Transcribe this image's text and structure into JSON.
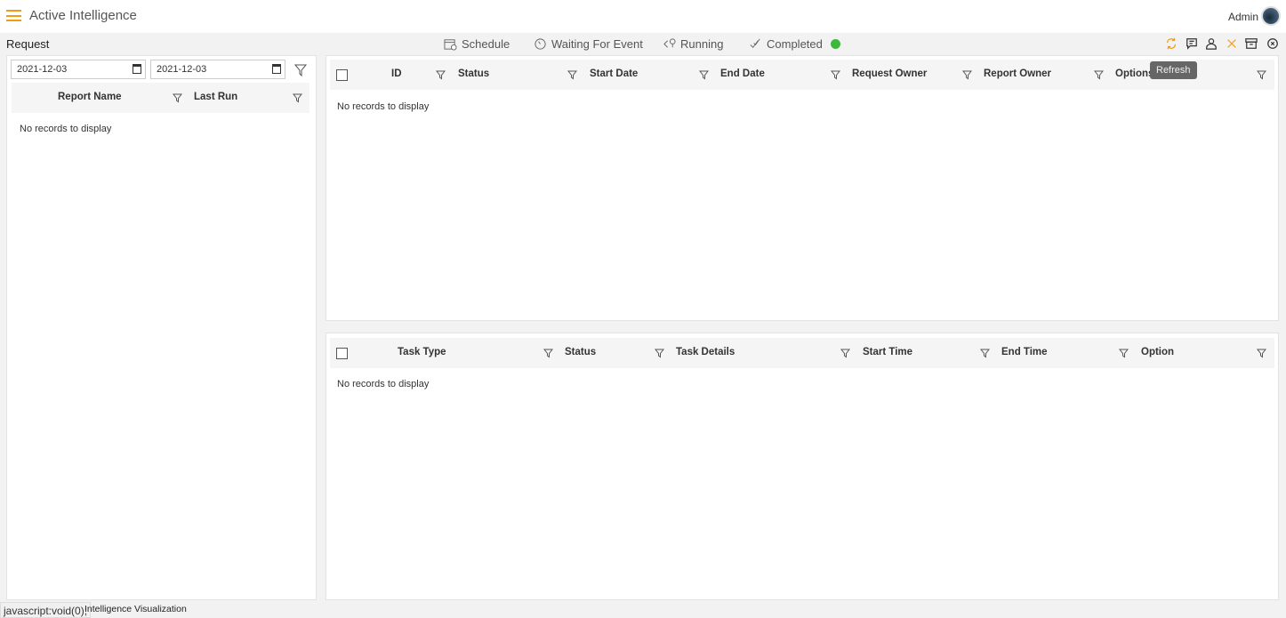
{
  "header": {
    "title": "Active Intelligence",
    "user": "Admin"
  },
  "left": {
    "title": "Request",
    "date_from": "2021-12-03",
    "date_to": "2021-12-03",
    "columns": [
      "Report Name",
      "Last Run"
    ],
    "empty": "No records to display"
  },
  "tabs": [
    {
      "label": "Schedule",
      "icon": "calendar-clock-icon"
    },
    {
      "label": "Waiting For Event",
      "icon": "timer-icon"
    },
    {
      "label": "Running",
      "icon": "running-icon"
    },
    {
      "label": "Completed",
      "icon": "double-check-icon",
      "status_color": "#3cb93c"
    }
  ],
  "toolbar": {
    "accent": "#f39c12",
    "tooltip": "Refresh",
    "icons": [
      "refresh-icon",
      "comment-icon",
      "user-icon",
      "close-icon",
      "archive-icon",
      "close-circle-icon"
    ]
  },
  "requests_table": {
    "columns": [
      "ID",
      "Status",
      "Start Date",
      "End Date",
      "Request Owner",
      "Report Owner",
      "Options"
    ],
    "empty": "No records to display"
  },
  "tasks_table": {
    "columns": [
      "Task Type",
      "Status",
      "Task Details",
      "Start Time",
      "End Time",
      "Option"
    ],
    "empty": "No records to display"
  },
  "statusbar": {
    "url": "javascript:void(0);",
    "label": "Intelligence Visualization"
  }
}
